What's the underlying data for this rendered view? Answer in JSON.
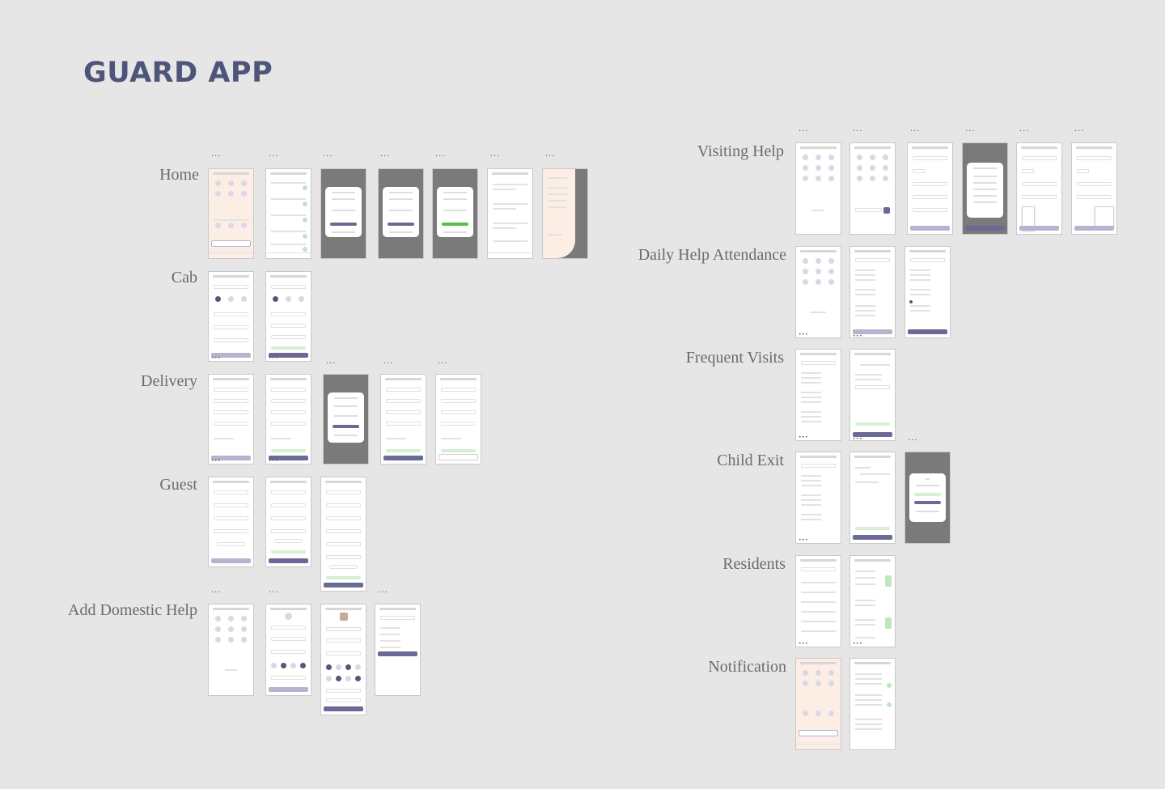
{
  "page": {
    "title": "GUARD APP",
    "colors": {
      "background": "#e6e6e6",
      "title": "#4e5578",
      "accent": "#6b6a96",
      "peach": "#fdeee5",
      "success": "#5cbd53"
    }
  },
  "sections": {
    "home": "Home",
    "cab": "Cab",
    "delivery": "Delivery",
    "guest": "Guest",
    "add_domestic_help": "Add Domestic Help",
    "visiting_help": "Visiting Help",
    "daily_help_attendance": "Daily Help Attendance",
    "frequent_visits": "Frequent Visits",
    "child_exit": "Child Exit",
    "residents": "Residents",
    "notification": "Notification"
  },
  "more_indicator": "...",
  "screen_counts": {
    "home": 7,
    "cab": 2,
    "delivery": 5,
    "guest": 3,
    "add_domestic_help": 4,
    "visiting_help": 6,
    "daily_help_attendance": 3,
    "frequent_visits": 2,
    "child_exit": 3,
    "residents": 2,
    "notification": 2
  }
}
